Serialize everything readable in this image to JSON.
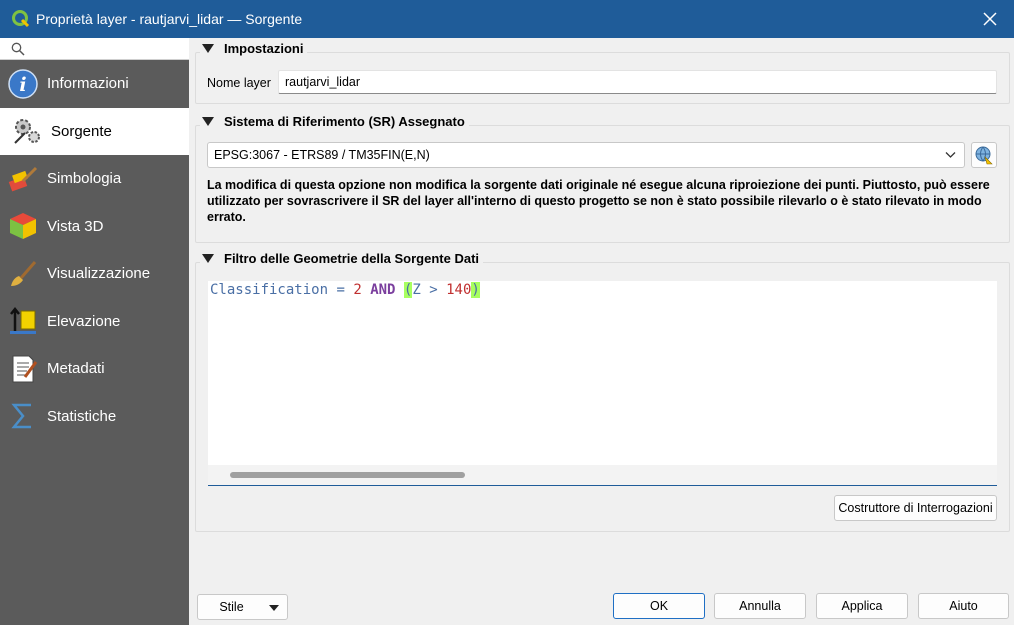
{
  "window": {
    "title": "Proprietà layer - rautjarvi_lidar — Sorgente"
  },
  "sidebar": {
    "items": [
      {
        "label": "Informazioni",
        "icon": "info-icon"
      },
      {
        "label": "Sorgente",
        "icon": "source-gear-icon",
        "active": true
      },
      {
        "label": "Simbologia",
        "icon": "symbology-brush-icon"
      },
      {
        "label": "Vista 3D",
        "icon": "cube-3d-icon"
      },
      {
        "label": "Visualizzazione",
        "icon": "rendering-brush-icon"
      },
      {
        "label": "Elevazione",
        "icon": "elevation-icon"
      },
      {
        "label": "Metadati",
        "icon": "metadata-icon"
      },
      {
        "label": "Statistiche",
        "icon": "sigma-icon"
      }
    ]
  },
  "settings": {
    "header": "Impostazioni",
    "layer_name_label": "Nome layer",
    "layer_name_value": "rautjarvi_lidar"
  },
  "crs": {
    "header": "Sistema di Riferimento (SR) Assegnato",
    "selected": "EPSG:3067 - ETRS89 / TM35FIN(E,N)",
    "note": "La modifica di questa opzione non modifica la sorgente dati originale né esegue alcuna riproiezione dei punti. Piuttosto, può essere utilizzato per sovrascrivere il SR del layer all'interno di questo progetto se non è stato possibile rilevarlo o è stato rilevato in modo errato."
  },
  "filter": {
    "header": "Filtro delle Geometrie della Sorgente Dati",
    "expression": {
      "field": "Classification",
      "op1": " = ",
      "val1": "2",
      "kw": "AND",
      "open": "(",
      "field2": "Z",
      "op2": " > ",
      "val2": "140",
      "close": ")"
    },
    "query_builder_label": "Costruttore di Interrogazioni"
  },
  "footer": {
    "style_label": "Stile",
    "ok_label": "OK",
    "cancel_label": "Annulla",
    "apply_label": "Applica",
    "help_label": "Aiuto"
  },
  "colors": {
    "titlebar": "#1f5c99",
    "sidebar": "#5b5b5b"
  }
}
